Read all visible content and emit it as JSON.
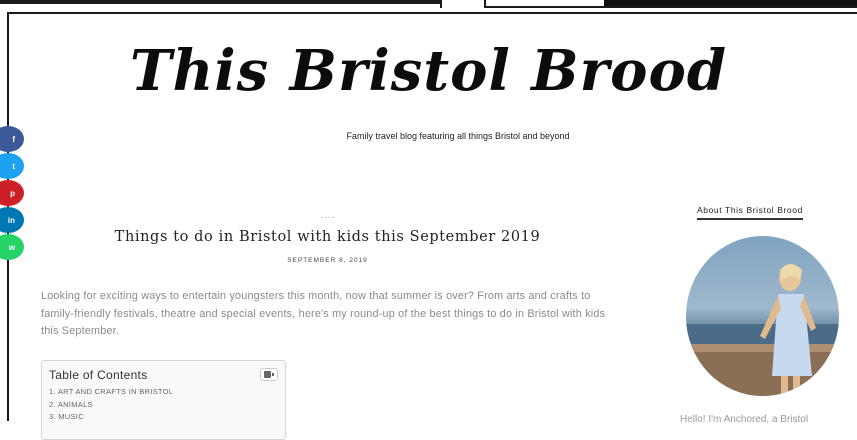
{
  "site": {
    "title": "This Bristol Brood",
    "tagline": "Family travel blog featuring all things Bristol and beyond"
  },
  "share_buttons": [
    {
      "label": "f",
      "network": "facebook",
      "color": "#3b5998"
    },
    {
      "label": "t",
      "network": "twitter",
      "color": "#1da1f2"
    },
    {
      "label": "p",
      "network": "pinterest",
      "color": "#cb2027"
    },
    {
      "label": "in",
      "network": "linkedin",
      "color": "#0077b5"
    },
    {
      "label": "w",
      "network": "whatsapp",
      "color": "#25d366"
    }
  ],
  "post": {
    "dots": "....",
    "title": "Things to do in Bristol with kids this September 2019",
    "date": "SEPTEMBER 8, 2019",
    "intro": "Looking for exciting ways to entertain youngsters this month, now that summer is over? From arts and crafts to family-friendly festivals, theatre and special events, here's my round-up of the best things to do in Bristol with kids this September."
  },
  "toc": {
    "title": "Table of Contents",
    "toggle_icon": "list-toggle-icon",
    "items": [
      "1. ART AND CRAFTS IN BRISTOL",
      "2. ANIMALS",
      "3. MUSIC"
    ]
  },
  "sidebar": {
    "heading": "About This Bristol Brood",
    "greeting": "Hello! I'm Anchored, a Bristol"
  },
  "colors": {
    "accent": "#222222",
    "body_text": "#8a8a8a",
    "background": "#ffffff"
  }
}
